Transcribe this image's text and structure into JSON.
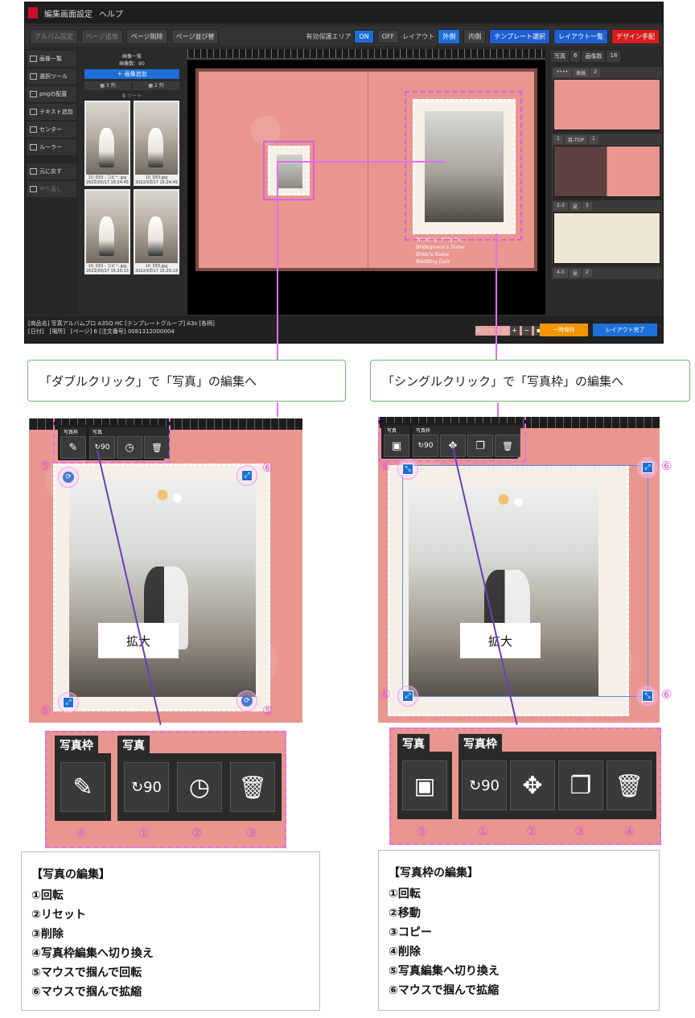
{
  "app": {
    "titlebar": {
      "menu_settings": "編集画面設定",
      "menu_help": "ヘルプ"
    },
    "toolbar": {
      "album_settings": "アルバム設定",
      "page_add": "ページ追加",
      "page_delete": "ページ削除",
      "page_reorder": "ページ並び替",
      "safe_area_label": "有効保護エリア",
      "safe_on": "ON",
      "safe_off": "OFF",
      "layout_label": "レイアウト",
      "layout_outer": "外側",
      "layout_inner": "内側",
      "template_select": "テンプレート選択",
      "layout_list": "レイアウト一覧",
      "design_notes": "デザイン手配"
    },
    "left_tools": [
      {
        "label": "画像一覧"
      },
      {
        "label": "選択ツール"
      },
      {
        "label": "pngの配置"
      },
      {
        "label": "テキスト追加"
      },
      {
        "label": "センター"
      },
      {
        "label": "ルーラー"
      },
      {
        "label": "元に戻す"
      },
      {
        "label": "やり直し"
      }
    ],
    "image_panel": {
      "title": "画像一覧",
      "count": "画像数：90",
      "add_button": "＋ 画像追加",
      "col3": "▦ 3 列",
      "col2": "▦ 2 列",
      "sort": "⇅ ソート",
      "thumbs": [
        {
          "name": "10_033 - コピー.jpg",
          "date": "2022/03/17 15:24:45"
        },
        {
          "name": "10_033.jpg",
          "date": "2022/03/17 15:24:45"
        },
        {
          "name": "10_033 - コピー.jpg",
          "date": "2022/03/17 15:25:13"
        },
        {
          "name": "10_033.jpg",
          "date": "2022/03/17 15:25:13"
        }
      ]
    },
    "spread_caption": [
      "Wedding of My Day",
      "Bridegroom's Name",
      "Bride's Name",
      "Wedding Date"
    ],
    "page_panel": {
      "tab_photos": "写真",
      "tab_photos_count": "6",
      "tab_images": "画像数",
      "tab_images_count": "18",
      "rows": [
        {
          "pages": "••••",
          "type": "表紙",
          "count": "2"
        },
        {
          "pages": "1",
          "type": "目-TOP",
          "count": "1"
        },
        {
          "pages": "2-3",
          "type": "見",
          "count": "3"
        },
        {
          "pages": "4-5",
          "type": "見",
          "count": "2"
        }
      ]
    },
    "status": {
      "line1": "[商品名] 写真アルバムプロ A3SQ HC [テンプレートグループ] A3s [各柄]",
      "line2": "[日付]　[場所]　[ページ] 6 [注文番号] 0081312000004",
      "zoom_label": "表示サイズ",
      "save_button": "一時保存",
      "done_button": "レイアウト完了"
    }
  },
  "instruct_left": "「ダブルクリック」で「写真」の編集へ",
  "instruct_right": "「シングルクリック」で「写真枠」の編集へ",
  "zoom_left": {
    "tab_frame": "写真枠",
    "tab_photo": "写真",
    "label": "拡大",
    "mark_rotate": "⑤",
    "mark_scale": "⑥"
  },
  "zoom_right": {
    "tab_photo": "写真",
    "tab_frame": "写真枠",
    "label": "拡大",
    "mark_scale": "⑥"
  },
  "detail_left": {
    "group1": "写真枠",
    "group2": "写真",
    "nums": [
      "④",
      "①",
      "②",
      "③"
    ]
  },
  "detail_right": {
    "group1": "写真",
    "group2": "写真枠",
    "nums": [
      "⑤",
      "①",
      "②",
      "③",
      "④"
    ]
  },
  "legend_left": {
    "title": "【写真の編集】",
    "items": [
      "①回転",
      "②リセット",
      "③削除",
      "④写真枠編集へ切り換え",
      "⑤マウスで掴んで回転",
      "⑥マウスで掴んで拡縮"
    ]
  },
  "legend_right": {
    "title": "【写真枠の編集】",
    "items": [
      "①回転",
      "②移動",
      "③コピー",
      "④削除",
      "⑤写真編集へ切り換え",
      "⑥マウスで掴んで拡縮"
    ]
  },
  "icons": {
    "rotate90": "↻90",
    "reset": "◷",
    "trash": "🗑",
    "edit_frame": "✎",
    "move": "✥",
    "copy": "❐",
    "image": "▣"
  }
}
